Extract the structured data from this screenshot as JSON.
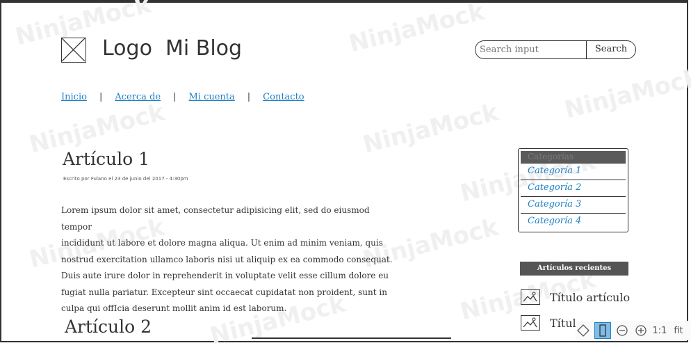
{
  "header": {
    "logo_label": "Logo",
    "blog_title": "Mi Blog",
    "logo_line": "Logo  Mi Blog"
  },
  "search": {
    "placeholder": "Search input",
    "button_label": "Search"
  },
  "nav": {
    "items": [
      {
        "label": "Inicio"
      },
      {
        "label": "Acerca de"
      },
      {
        "label": "Mi cuenta"
      },
      {
        "label": "Contacto"
      }
    ]
  },
  "articles": [
    {
      "title": "Artículo 1",
      "byline": "Escrito por Fulano el 23 de junio del 2017 - 4:30pm",
      "body": [
        "Lorem ipsum dolor sit amet, consectetur adipisicing elit, sed do eiusmod tempor",
        "incididunt ut labore et dolore magna aliqua. Ut enim ad minim veniam, quis",
        "nostrud exercitation ullamco laboris nisi ut aliquip ex ea commodo consequat.",
        "Duis aute irure dolor in reprehenderit in voluptate velit esse cillum dolore eu",
        "fugiat nulla pariatur. Excepteur sint occaecat cupidatat non proident, sunt in",
        "culpa qui offIcia deserunt mollit anim id est laborum."
      ]
    },
    {
      "title": "Artículo 2"
    }
  ],
  "categories": {
    "heading": "Categorías",
    "items": [
      "Categoría 1",
      "Categoría 2",
      "Categoría 3",
      "Categoría 4"
    ]
  },
  "recent": {
    "heading": "Artículos recientes",
    "items": [
      "Título artículo",
      "Títul"
    ]
  },
  "watermark": "NinjaMock",
  "toolbar": {
    "zoom_1to1": "1:1",
    "fit": "fit"
  }
}
